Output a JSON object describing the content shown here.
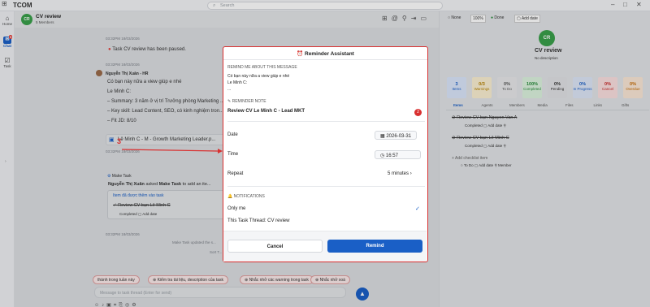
{
  "app": {
    "name": "TCOM",
    "search_placeholder": "Search"
  },
  "nav": {
    "home": "Home",
    "chat": "Chat",
    "chat_badge": "9",
    "task": "Task"
  },
  "chat": {
    "avatar": "CR",
    "title": "CV review",
    "members": "5 Members",
    "ts1": "03:32PM 18/03/2026",
    "paused": "Task CV review has been paused.",
    "ts2": "03:32PM 18/03/2026",
    "sender": "Nguyễn Thị Xuân - HR",
    "lines": [
      "Có bạn này nữa a view giúp e nhé",
      "Le Minh C:",
      "– Summary: 3 năm ở vị trí Trưởng phòng Marketing ...",
      "– Key skill: Lead Content, SEO, có kinh nghiệm tron...",
      "– Fit JD: 8/10"
    ],
    "file": "Lê Minh C - M - Growth Marketing Leader.p...",
    "ts3": "03:32PM 18/03/2026",
    "make_task": "Make Task",
    "assign_actor": "Nguyễn Thị Xuân",
    "assign_mid": "asked",
    "assign_obj": "Make Task",
    "assign_tail": "to add an ite...",
    "added_title": "Item đã được thêm vào task",
    "added_item": "Review CV bạn Lê Minh C",
    "completed": "Completed",
    "add_date": "Add date",
    "ts4": "03:32PM 18/03/2026",
    "update_note": "Make Task updated the s...",
    "sort_note": "Sort T...",
    "chips": [
      "thành trong tuần này",
      "Kiểm tra tài liệu, description của task",
      "Nhắc nhở các warning trong task",
      "Nhắc nhở xoá"
    ],
    "input_placeholder": "Message to task thread (Enter for send)"
  },
  "right": {
    "none": "None",
    "percent": "100%",
    "done": "Done",
    "add_date": "Add date",
    "avatar": "CR",
    "title": "CV review",
    "desc": "No description",
    "stats": [
      {
        "n": "3",
        "l": "Items",
        "c": "#dbe6fb",
        "t": "#1a5fc6"
      },
      {
        "n": "0/3",
        "l": "Warnings",
        "c": "#fbf0d2",
        "t": "#b58100"
      },
      {
        "n": "0%",
        "l": "To Do",
        "c": "#e7e8ea",
        "t": "#555"
      },
      {
        "n": "100%",
        "l": "Completed",
        "c": "#dcf3df",
        "t": "#2a8c3c"
      },
      {
        "n": "0%",
        "l": "Pending",
        "c": "#e1e2e5",
        "t": "#333"
      },
      {
        "n": "0%",
        "l": "In Progress",
        "c": "#dde6f8",
        "t": "#1a5fc6"
      },
      {
        "n": "0%",
        "l": "Cancel",
        "c": "#fbe0e0",
        "t": "#c62828"
      },
      {
        "n": "0%",
        "l": "Overdue",
        "c": "#fbe8d7",
        "t": "#c66a00"
      }
    ],
    "tabs": [
      "Items",
      "Agents",
      "Members",
      "Media",
      "Files",
      "Links",
      "Gifts"
    ],
    "tasks": [
      "Review CV bạn Nguyen Van A",
      "Review CV bạn Lê Minh C"
    ],
    "completed": "Completed",
    "add_checklist": "Add checklist item",
    "todo": "To Do",
    "member": "Member"
  },
  "modal": {
    "title": "Reminder Assistant",
    "remind_label": "REMIND ME ABOUT THIS MESSAGE",
    "msg_lines": [
      "Có bạn này nữa a view giúp e nhé",
      "Le Minh C:",
      "..."
    ],
    "note_label": "REMINDER NOTE",
    "note_value": "Review CV Le Minh C - Lead MKT",
    "note_badge": "2",
    "date_label": "Date",
    "date_value": "2026-03-31",
    "time_label": "Time",
    "time_value": "16:57",
    "repeat_label": "Repeat",
    "repeat_value": "5 minutes",
    "notif_label": "NOTIFICATIONS",
    "only_me": "Only me",
    "thread": "This Task Thread: CV review",
    "cancel": "Cancel",
    "remind": "Remind"
  },
  "annotation": {
    "number": "3",
    "color": "#d93030"
  }
}
